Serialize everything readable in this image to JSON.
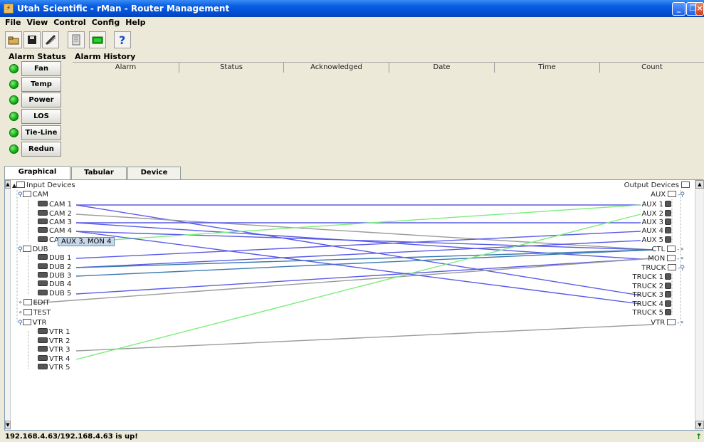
{
  "window": {
    "title": "Utah Scientific - rMan - Router Management"
  },
  "menu": [
    "File",
    "View",
    "Control",
    "Config",
    "Help"
  ],
  "toolbar": {
    "icons": [
      "open-icon",
      "save-icon",
      "edit-icon",
      "panel-icon",
      "monitor-icon",
      "help-icon"
    ]
  },
  "alarm_status": {
    "label": "Alarm Status",
    "items": [
      "Fan",
      "Temp",
      "Power",
      "LOS",
      "Tie-Line",
      "Redun"
    ]
  },
  "alarm_history": {
    "label": "Alarm History",
    "columns": [
      "Alarm",
      "Status",
      "Acknowledged",
      "Date",
      "Time",
      "Count"
    ]
  },
  "tabs": [
    "Graphical Status",
    "Tabular Status",
    "Device Config"
  ],
  "input_tree": {
    "root": "Input Devices",
    "groups": [
      {
        "name": "CAM",
        "items": [
          "CAM  1",
          "CAM  2",
          "CAM  3",
          "CAM  4",
          "CA"
        ]
      },
      {
        "name": "DUB",
        "items": [
          "DUB  1",
          "DUB  2",
          "DUB  3",
          "DUB  4",
          "DUB  5"
        ]
      },
      {
        "name": "EDIT",
        "items": []
      },
      {
        "name": "TEST",
        "items": []
      },
      {
        "name": "VTR",
        "items": [
          "VTR  1",
          "VTR  2",
          "VTR  3",
          "VTR  4",
          "VTR  5"
        ]
      }
    ]
  },
  "tooltip": "AUX  3, MON  4",
  "output_tree": {
    "root": "Output Devices",
    "groups": [
      {
        "name": "AUX",
        "items": [
          "AUX  1",
          "AUX  2",
          "AUX  3",
          "AUX  4",
          "AUX  5"
        ]
      },
      {
        "name": "CTL",
        "items": []
      },
      {
        "name": "MON",
        "items": []
      },
      {
        "name": "TRUCK",
        "items": [
          "TRUCK 1",
          "TRUCK 2",
          "TRUCK 3",
          "TRUCK 4",
          "TRUCK 5"
        ]
      },
      {
        "name": "VTR",
        "items": []
      }
    ]
  },
  "status": {
    "text": "192.168.4.63/192.168.4.63 is up!"
  },
  "colors": {
    "route_blue": "#5a5ae8",
    "route_green": "#7aee7a",
    "route_gray": "#9a9a9a",
    "route_teal": "#3a7ab0"
  }
}
